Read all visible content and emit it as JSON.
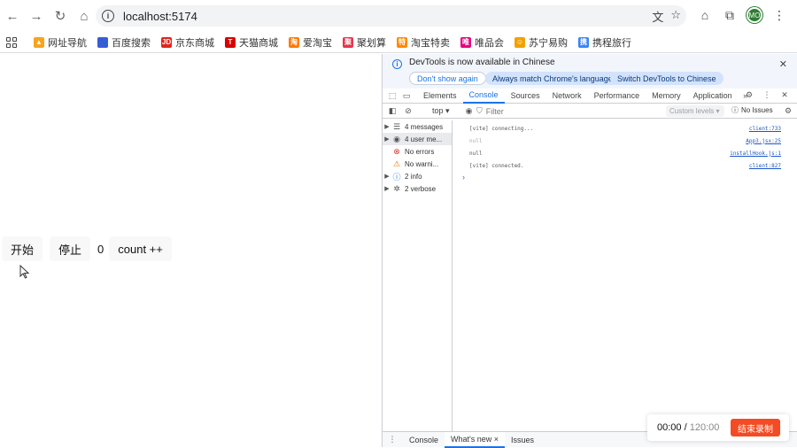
{
  "browser": {
    "url": "localhost:5174",
    "avatar": "MO",
    "bookmarks": [
      {
        "label": "网址导航",
        "color": "#f7a41d",
        "glyph": "▲"
      },
      {
        "label": "百度搜索",
        "color": "#3a5bd9",
        "glyph": "🐾"
      },
      {
        "label": "京东商城",
        "color": "#e1251b",
        "glyph": "JD"
      },
      {
        "label": "天猫商城",
        "color": "#d80000",
        "glyph": "T"
      },
      {
        "label": "爱淘宝",
        "color": "#ff7a00",
        "glyph": "淘"
      },
      {
        "label": "聚划算",
        "color": "#e8344b",
        "glyph": "聚"
      },
      {
        "label": "淘宝特卖",
        "color": "#ff8a00",
        "glyph": "特"
      },
      {
        "label": "唯品会",
        "color": "#e6007e",
        "glyph": "唯"
      },
      {
        "label": "苏宁易购",
        "color": "#f2a100",
        "glyph": "☺"
      },
      {
        "label": "携程旅行",
        "color": "#3b83f6",
        "glyph": "携"
      }
    ]
  },
  "app": {
    "start_label": "开始",
    "stop_label": "停止",
    "count_value": "0",
    "increment_label": "count ++"
  },
  "devtools": {
    "banner_text": "DevTools is now available in Chinese",
    "dont_show": "Don't show again",
    "match_lang": "Always match Chrome's language",
    "switch_lang": "Switch DevTools to Chinese",
    "tabs": [
      "Elements",
      "Console",
      "Sources",
      "Network",
      "Performance",
      "Memory",
      "Application"
    ],
    "active_tab": "Console",
    "context": "top ▾",
    "filter_placeholder": "Filter",
    "levels": "Custom levels ▾",
    "issues": "No Issues",
    "sidebar": [
      {
        "label": "4 messages",
        "icon": "☰",
        "arrow": "▶",
        "color": "#555"
      },
      {
        "label": "4 user me...",
        "icon": "◉",
        "arrow": "▶",
        "color": "#555"
      },
      {
        "label": "No errors",
        "icon": "⊗",
        "arrow": "",
        "color": "#d93025"
      },
      {
        "label": "No warni...",
        "icon": "⚠",
        "arrow": "",
        "color": "#e37400"
      },
      {
        "label": "2 info",
        "icon": "ⓘ",
        "arrow": "▶",
        "color": "#1a73e8"
      },
      {
        "label": "2 verbose",
        "icon": "✲",
        "arrow": "▶",
        "color": "#555"
      }
    ],
    "logs": [
      {
        "msg": "[vite] connecting...",
        "src": "client:733",
        "dim": false
      },
      {
        "msg": "null",
        "src": "App3.jsx:25",
        "dim": true
      },
      {
        "msg": "null",
        "src": "installHook.js:1",
        "dim": false
      },
      {
        "msg": "[vite] connected.",
        "src": "client:827",
        "dim": false
      }
    ],
    "drawer_tabs": [
      "Console",
      "What's new ×",
      "Issues"
    ],
    "drawer_active": "What's new ×"
  },
  "recorder": {
    "elapsed": "00:00",
    "separator": " / ",
    "total": "120:00",
    "stop_label": "结束录制"
  }
}
